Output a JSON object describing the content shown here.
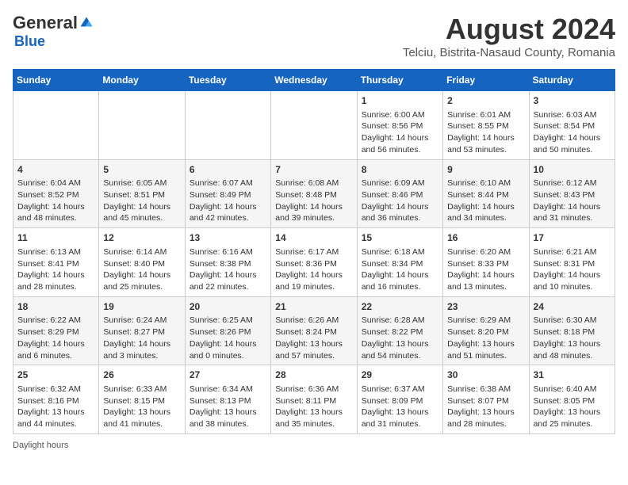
{
  "header": {
    "logo": {
      "general": "General",
      "blue": "Blue"
    },
    "title": "August 2024",
    "location": "Telciu, Bistrita-Nasaud County, Romania"
  },
  "days_of_week": [
    "Sunday",
    "Monday",
    "Tuesday",
    "Wednesday",
    "Thursday",
    "Friday",
    "Saturday"
  ],
  "footer": {
    "daylight_label": "Daylight hours"
  },
  "weeks": [
    [
      {
        "day": "",
        "info": ""
      },
      {
        "day": "",
        "info": ""
      },
      {
        "day": "",
        "info": ""
      },
      {
        "day": "",
        "info": ""
      },
      {
        "day": "1",
        "info": "Sunrise: 6:00 AM\nSunset: 8:56 PM\nDaylight: 14 hours\nand 56 minutes."
      },
      {
        "day": "2",
        "info": "Sunrise: 6:01 AM\nSunset: 8:55 PM\nDaylight: 14 hours\nand 53 minutes."
      },
      {
        "day": "3",
        "info": "Sunrise: 6:03 AM\nSunset: 8:54 PM\nDaylight: 14 hours\nand 50 minutes."
      }
    ],
    [
      {
        "day": "4",
        "info": "Sunrise: 6:04 AM\nSunset: 8:52 PM\nDaylight: 14 hours\nand 48 minutes."
      },
      {
        "day": "5",
        "info": "Sunrise: 6:05 AM\nSunset: 8:51 PM\nDaylight: 14 hours\nand 45 minutes."
      },
      {
        "day": "6",
        "info": "Sunrise: 6:07 AM\nSunset: 8:49 PM\nDaylight: 14 hours\nand 42 minutes."
      },
      {
        "day": "7",
        "info": "Sunrise: 6:08 AM\nSunset: 8:48 PM\nDaylight: 14 hours\nand 39 minutes."
      },
      {
        "day": "8",
        "info": "Sunrise: 6:09 AM\nSunset: 8:46 PM\nDaylight: 14 hours\nand 36 minutes."
      },
      {
        "day": "9",
        "info": "Sunrise: 6:10 AM\nSunset: 8:44 PM\nDaylight: 14 hours\nand 34 minutes."
      },
      {
        "day": "10",
        "info": "Sunrise: 6:12 AM\nSunset: 8:43 PM\nDaylight: 14 hours\nand 31 minutes."
      }
    ],
    [
      {
        "day": "11",
        "info": "Sunrise: 6:13 AM\nSunset: 8:41 PM\nDaylight: 14 hours\nand 28 minutes."
      },
      {
        "day": "12",
        "info": "Sunrise: 6:14 AM\nSunset: 8:40 PM\nDaylight: 14 hours\nand 25 minutes."
      },
      {
        "day": "13",
        "info": "Sunrise: 6:16 AM\nSunset: 8:38 PM\nDaylight: 14 hours\nand 22 minutes."
      },
      {
        "day": "14",
        "info": "Sunrise: 6:17 AM\nSunset: 8:36 PM\nDaylight: 14 hours\nand 19 minutes."
      },
      {
        "day": "15",
        "info": "Sunrise: 6:18 AM\nSunset: 8:34 PM\nDaylight: 14 hours\nand 16 minutes."
      },
      {
        "day": "16",
        "info": "Sunrise: 6:20 AM\nSunset: 8:33 PM\nDaylight: 14 hours\nand 13 minutes."
      },
      {
        "day": "17",
        "info": "Sunrise: 6:21 AM\nSunset: 8:31 PM\nDaylight: 14 hours\nand 10 minutes."
      }
    ],
    [
      {
        "day": "18",
        "info": "Sunrise: 6:22 AM\nSunset: 8:29 PM\nDaylight: 14 hours\nand 6 minutes."
      },
      {
        "day": "19",
        "info": "Sunrise: 6:24 AM\nSunset: 8:27 PM\nDaylight: 14 hours\nand 3 minutes."
      },
      {
        "day": "20",
        "info": "Sunrise: 6:25 AM\nSunset: 8:26 PM\nDaylight: 14 hours\nand 0 minutes."
      },
      {
        "day": "21",
        "info": "Sunrise: 6:26 AM\nSunset: 8:24 PM\nDaylight: 13 hours\nand 57 minutes."
      },
      {
        "day": "22",
        "info": "Sunrise: 6:28 AM\nSunset: 8:22 PM\nDaylight: 13 hours\nand 54 minutes."
      },
      {
        "day": "23",
        "info": "Sunrise: 6:29 AM\nSunset: 8:20 PM\nDaylight: 13 hours\nand 51 minutes."
      },
      {
        "day": "24",
        "info": "Sunrise: 6:30 AM\nSunset: 8:18 PM\nDaylight: 13 hours\nand 48 minutes."
      }
    ],
    [
      {
        "day": "25",
        "info": "Sunrise: 6:32 AM\nSunset: 8:16 PM\nDaylight: 13 hours\nand 44 minutes."
      },
      {
        "day": "26",
        "info": "Sunrise: 6:33 AM\nSunset: 8:15 PM\nDaylight: 13 hours\nand 41 minutes."
      },
      {
        "day": "27",
        "info": "Sunrise: 6:34 AM\nSunset: 8:13 PM\nDaylight: 13 hours\nand 38 minutes."
      },
      {
        "day": "28",
        "info": "Sunrise: 6:36 AM\nSunset: 8:11 PM\nDaylight: 13 hours\nand 35 minutes."
      },
      {
        "day": "29",
        "info": "Sunrise: 6:37 AM\nSunset: 8:09 PM\nDaylight: 13 hours\nand 31 minutes."
      },
      {
        "day": "30",
        "info": "Sunrise: 6:38 AM\nSunset: 8:07 PM\nDaylight: 13 hours\nand 28 minutes."
      },
      {
        "day": "31",
        "info": "Sunrise: 6:40 AM\nSunset: 8:05 PM\nDaylight: 13 hours\nand 25 minutes."
      }
    ]
  ]
}
